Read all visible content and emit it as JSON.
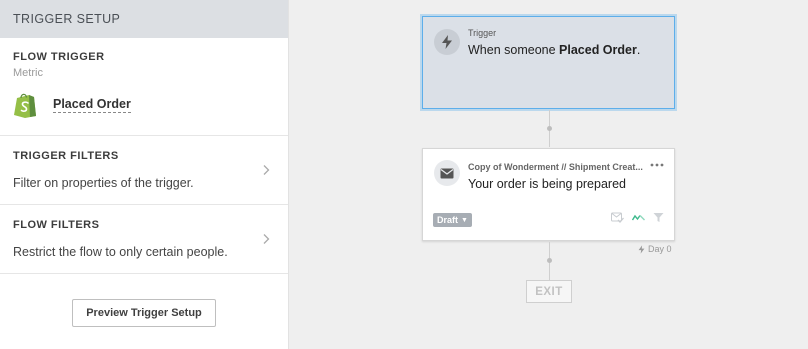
{
  "sidebar": {
    "header": "TRIGGER SETUP",
    "flow_trigger": {
      "title": "FLOW TRIGGER",
      "subtitle": "Metric",
      "metric_name": "Placed Order",
      "metric_icon": "shopify-icon"
    },
    "trigger_filters": {
      "title": "TRIGGER FILTERS",
      "description": "Filter on properties of the trigger."
    },
    "flow_filters": {
      "title": "FLOW FILTERS",
      "description": "Restrict the flow to only certain people."
    },
    "preview_button": "Preview Trigger Setup"
  },
  "canvas": {
    "trigger_node": {
      "label": "Trigger",
      "text_prefix": "When someone ",
      "text_metric": "Placed Order",
      "text_suffix": "."
    },
    "email_node": {
      "title": "Copy of Wonderment // Shipment Creat...",
      "subject": "Your order is being prepared",
      "status": "Draft"
    },
    "delay": "Day 0",
    "exit": "EXIT"
  },
  "colors": {
    "selected_border": "#5daeea",
    "trigger_bg": "#dbe0e7",
    "shopify_green": "#95bf47",
    "sidebar_header_bg": "#dcdfe3"
  }
}
